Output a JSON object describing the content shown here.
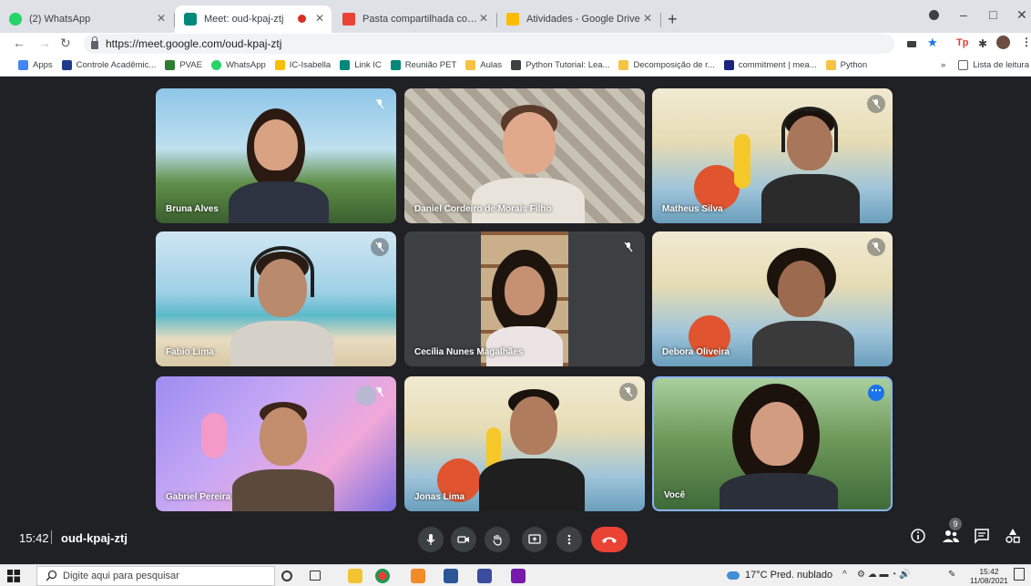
{
  "browser": {
    "tabs": [
      {
        "label": "(2) WhatsApp",
        "icon": "whatsapp-icon",
        "color": "#25d366"
      },
      {
        "label": "Meet: oud-kpaj-ztj",
        "icon": "meet-icon",
        "color": "#00897b",
        "recording": true
      },
      {
        "label": "Pasta compartilhada com você: ",
        "icon": "gmail-icon",
        "color": "#ea4335"
      },
      {
        "label": "Atividades - Google Drive",
        "icon": "drive-icon",
        "color": "#fbbc04"
      }
    ],
    "url": "https://meet.google.com/oud-kpaj-ztj",
    "bookmarks": [
      {
        "label": "Apps",
        "color": "#4285f4"
      },
      {
        "label": "Controle Acadêmic...",
        "color": "#1e3a8a"
      },
      {
        "label": "PVAE",
        "color": "#2e7d32"
      },
      {
        "label": "WhatsApp",
        "color": "#25d366"
      },
      {
        "label": "IC-Isabella",
        "color": "#fbbc04"
      },
      {
        "label": "Link IC",
        "color": "#00897b"
      },
      {
        "label": "Reunião PET",
        "color": "#00897b"
      },
      {
        "label": "Aulas",
        "color": "#f6c343"
      },
      {
        "label": "Python Tutorial: Lea...",
        "color": "#3c4043"
      },
      {
        "label": "Decomposição de r...",
        "color": "#f6c343"
      },
      {
        "label": "commitment | mea...",
        "color": "#1a237e"
      },
      {
        "label": "Python",
        "color": "#f6c343"
      }
    ],
    "reading_list": "Lista de leitura",
    "more_bookmarks": "»"
  },
  "meet": {
    "participants": [
      {
        "name": "Bruna Alves",
        "muted": true
      },
      {
        "name": "Daniel Cordeiro de Morais Filho",
        "muted": false
      },
      {
        "name": "Matheus Silva",
        "muted": true
      },
      {
        "name": "Fabio Lima",
        "muted": true
      },
      {
        "name": "Cecília Nunes Magalhães",
        "muted": true
      },
      {
        "name": "Debora Oliveira",
        "muted": true
      },
      {
        "name": "Gabriel Pereira",
        "muted": true
      },
      {
        "name": "Jonas Lima",
        "muted": true
      },
      {
        "name": "Você",
        "muted": false
      }
    ],
    "time": "15:42",
    "meeting_code": "oud-kpaj-ztj",
    "people_count": "9",
    "colors": {
      "end_call": "#ea4335",
      "self_border": "#8ab4f8",
      "more_button": "#1a73e8"
    }
  },
  "taskbar": {
    "search_placeholder": "Digite aqui para pesquisar",
    "weather": "17°C  Pred. nublado",
    "clock_time": "15:42",
    "clock_date": "11/08/2021"
  }
}
